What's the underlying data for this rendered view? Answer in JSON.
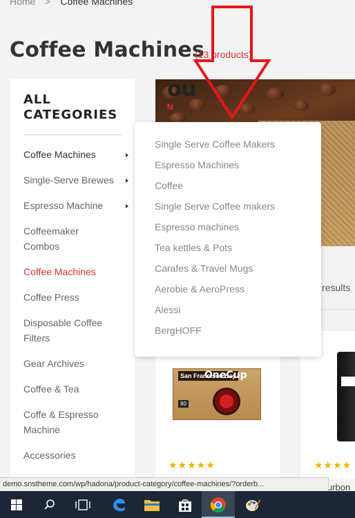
{
  "breadcrumb": {
    "home": "Home",
    "separator": ">",
    "current": "Coffee Machines"
  },
  "page": {
    "title": "Coffee Machines",
    "product_count": "(13 products)"
  },
  "sidebar": {
    "title_line1": "ALL",
    "title_line2": "CATEGORIES",
    "items": [
      {
        "label": "Coffee Machines",
        "has_submenu": true
      },
      {
        "label": "Single-Serve Brewes",
        "has_submenu": true
      },
      {
        "label": "Espresso Machine",
        "has_submenu": true
      },
      {
        "label": "Coffeemaker Combos",
        "has_submenu": false
      },
      {
        "label": "Coffee Machines",
        "has_submenu": false,
        "active": true
      },
      {
        "label": "Coffee Press",
        "has_submenu": false
      },
      {
        "label": "Disposable Coffee Filters",
        "has_submenu": false
      },
      {
        "label": "Gear Archives",
        "has_submenu": false
      },
      {
        "label": "Coffee & Tea",
        "has_submenu": false
      },
      {
        "label": "Coffe & Espresso Machine",
        "has_submenu": false
      },
      {
        "label": "Accessories",
        "has_submenu": false
      }
    ]
  },
  "dropdown": {
    "items": [
      "Single Serve Coffee Makers",
      "Espresso Machines",
      "Coffee",
      "Single Serve Coffee makers",
      "Espresso machines",
      "Tea kettles & Pots",
      "Carafes & Travel Mugs",
      "Aerobie & AeroPress",
      "Alessi",
      "BergHOFF"
    ]
  },
  "banner": {
    "text": "ou",
    "subtext": "N"
  },
  "toolbar": {
    "results_text": "results"
  },
  "products": [
    {
      "box_brand": "San Francisco Bay",
      "box_label": "OneCup",
      "box_count": "80",
      "stars": "★★★★★"
    },
    {
      "stars": "★★★★",
      "title": "urbon c"
    }
  ],
  "status_bar": {
    "url": "demo.snstheme.com/wp/hadona/product-category/coffee-machines/?orderb..."
  },
  "taskbar": {
    "icons": [
      "windows-start-icon",
      "search-icon",
      "task-view-icon",
      "edge-icon",
      "file-explorer-icon",
      "store-icon",
      "chrome-icon",
      "paint-icon"
    ],
    "active": "chrome-icon"
  },
  "colors": {
    "accent_red": "#e03131",
    "star_gold": "#f0b400",
    "taskbar_bg": "#1c2634"
  }
}
